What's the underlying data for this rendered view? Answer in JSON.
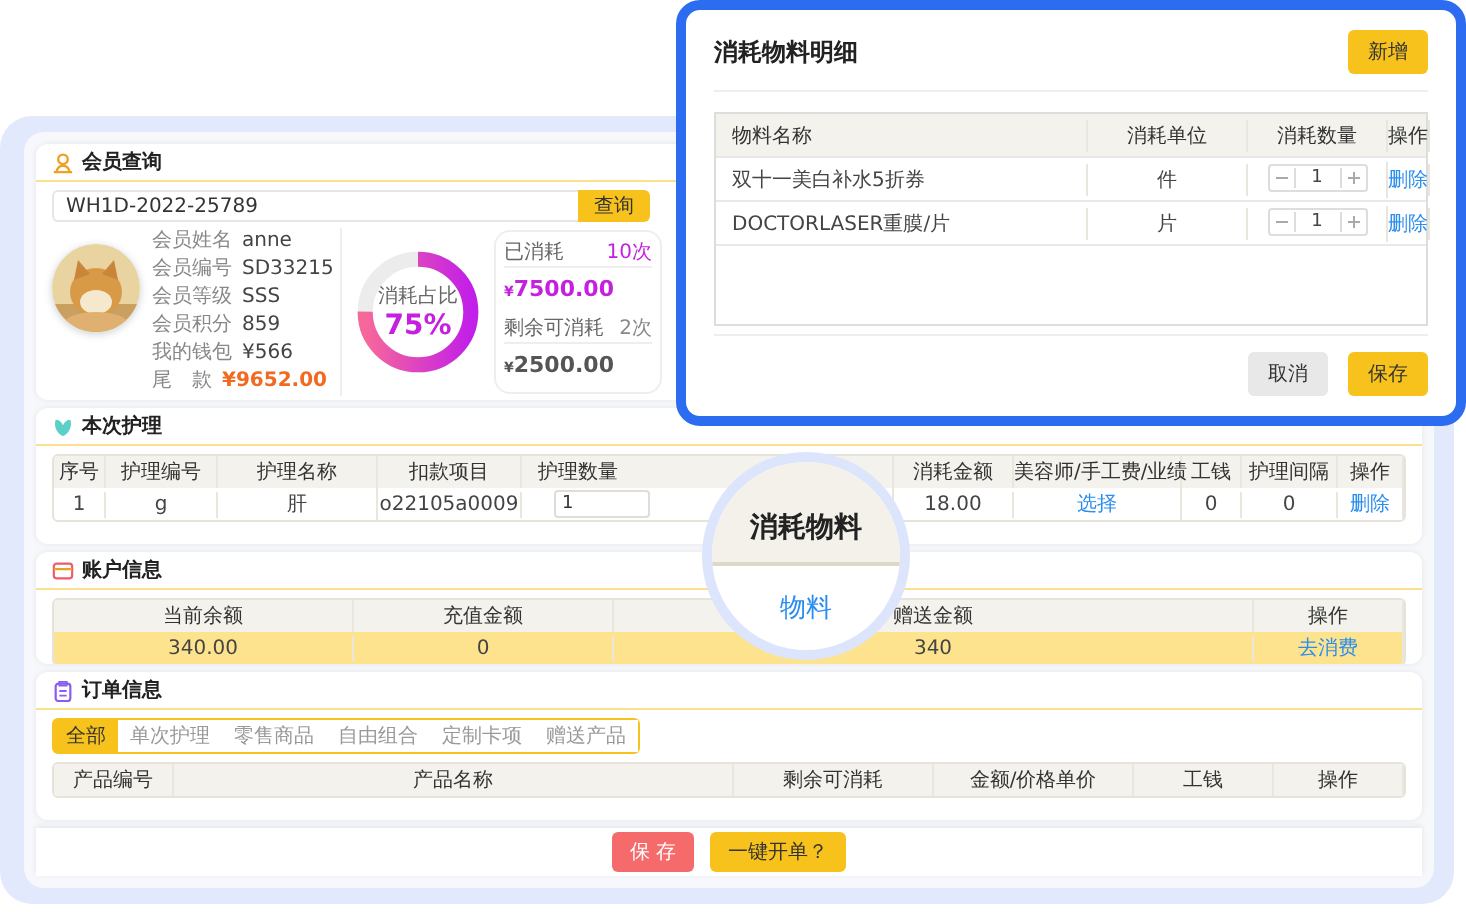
{
  "member_search": {
    "title": "会员查询",
    "search": {
      "value": "WH1D-2022-25789"
    },
    "search_button": "查询",
    "fields": [
      {
        "label": "会员姓名",
        "value": "anne",
        "kind": "plain"
      },
      {
        "label": "会员编号",
        "value": "SD33215",
        "kind": "plain"
      },
      {
        "label": "会员等级",
        "value": "SSS",
        "kind": "plain"
      },
      {
        "label": "会员积分",
        "value": "859",
        "kind": "plain"
      },
      {
        "label": "我的钱包",
        "value": "¥566",
        "kind": "plain"
      },
      {
        "label": "尾　款",
        "value": "¥9652.00",
        "kind": "highlight"
      }
    ],
    "ratio": {
      "label": "消耗占比",
      "value": "75%",
      "level": 0.75
    },
    "stats": [
      {
        "label": "已消耗",
        "count": "10次",
        "currency": "¥",
        "amount": "7500.00",
        "kind": "used"
      },
      {
        "label": "剩余可消耗",
        "count": "2次",
        "currency": "¥",
        "amount": "2500.00",
        "kind": "remaining"
      }
    ]
  },
  "care": {
    "title": "本次护理",
    "columns": [
      "序号",
      "护理编号",
      "护理名称",
      "扣款项目",
      "护理数量",
      "消耗金额",
      "美容师/手工费/业绩",
      "工钱",
      "护理间隔",
      "操作"
    ],
    "rows": [
      {
        "index": "1",
        "code": "g",
        "name": "肝",
        "item": "o22105a0009",
        "quantity": "1",
        "amount": "18.00",
        "staff_link": "选择",
        "fee": "0",
        "interval": "0",
        "action": "删除"
      }
    ]
  },
  "account": {
    "title": "账户信息",
    "columns": [
      "当前余额",
      "充值金额",
      "赠送金额",
      "操作"
    ],
    "rows": [
      {
        "balance": "340.00",
        "recharge": "0",
        "gift": "340",
        "action": "去消费"
      }
    ]
  },
  "orders": {
    "title": "订单信息",
    "tabs": [
      {
        "label": "全部",
        "selected": true
      },
      {
        "label": "单次护理",
        "selected": false
      },
      {
        "label": "零售商品",
        "selected": false
      },
      {
        "label": "自由组合",
        "selected": false
      },
      {
        "label": "定制卡项",
        "selected": false
      },
      {
        "label": "赠送产品",
        "selected": false
      }
    ],
    "columns": [
      "产品编号",
      "产品名称",
      "剩余可消耗",
      "金额/价格单价",
      "工钱",
      "操作"
    ]
  },
  "footer": {
    "save_button": "保 存",
    "quick_order_button": "一键开单？"
  },
  "magnifier": {
    "heading": "消耗物料",
    "item": "物料"
  },
  "material_dialog": {
    "title": "消耗物料明细",
    "add_button": "新增",
    "columns": [
      "物料名称",
      "消耗单位",
      "消耗数量",
      "操作"
    ],
    "rows": [
      {
        "name": "双十一美白补水5折券",
        "unit": "件",
        "quantity": "1",
        "action": "删除"
      },
      {
        "name": "DOCTORLASER重膜/片",
        "unit": "片",
        "quantity": "1",
        "action": "删除"
      }
    ],
    "cancel_button": "取消",
    "save_button": "保存"
  }
}
